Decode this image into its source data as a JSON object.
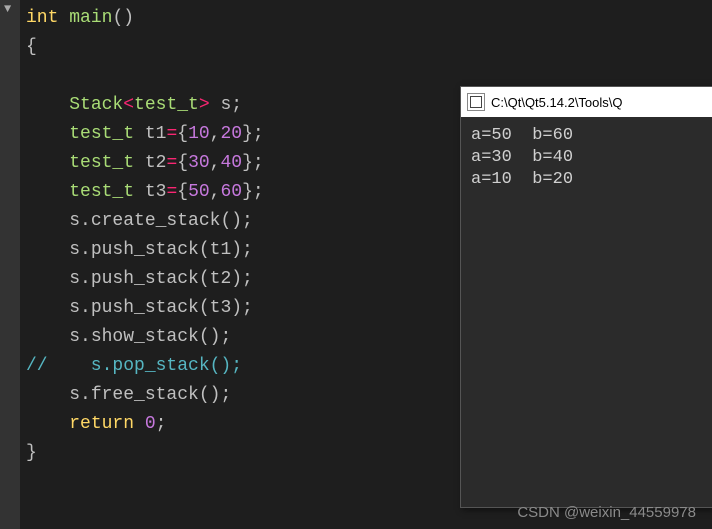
{
  "code": {
    "l1_kw": "int",
    "l1_fn": "main",
    "l1_par": "()",
    "l2": "{",
    "l4_type1": "Stack",
    "l4_ang_open": "<",
    "l4_tpl": "test_t",
    "l4_ang_close": ">",
    "l4_rest": " s;",
    "l5_type": "test_t",
    "l5_var": " t1",
    "l5_eq": "=",
    "l5_open": "{",
    "l5_n1": "10",
    "l5_comma": ",",
    "l5_n2": "20",
    "l5_close": "};",
    "l6_type": "test_t",
    "l6_var": " t2",
    "l6_eq": "=",
    "l6_open": "{",
    "l6_n1": "30",
    "l6_comma": ",",
    "l6_n2": "40",
    "l6_close": "};",
    "l7_type": "test_t",
    "l7_var": " t3",
    "l7_eq": "=",
    "l7_open": "{",
    "l7_n1": "50",
    "l7_comma": ",",
    "l7_n2": "60",
    "l7_close": "};",
    "l8": "s.create_stack();",
    "l9": "s.push_stack(t1);",
    "l10": "s.push_stack(t2);",
    "l11": "s.push_stack(t3);",
    "l12": "s.show_stack();",
    "l13": "//    s.pop_stack();",
    "l14": "s.free_stack();",
    "l15_kw": "return",
    "l15_sp": " ",
    "l15_zero": "0",
    "l15_semi": ";",
    "l16": "}"
  },
  "outputWindow": {
    "title": "C:\\Qt\\Qt5.14.2\\Tools\\Q",
    "lines": [
      "a=50  b=60",
      "a=30  b=40",
      "a=10  b=20"
    ]
  },
  "watermark": "CSDN @weixin_44559978"
}
